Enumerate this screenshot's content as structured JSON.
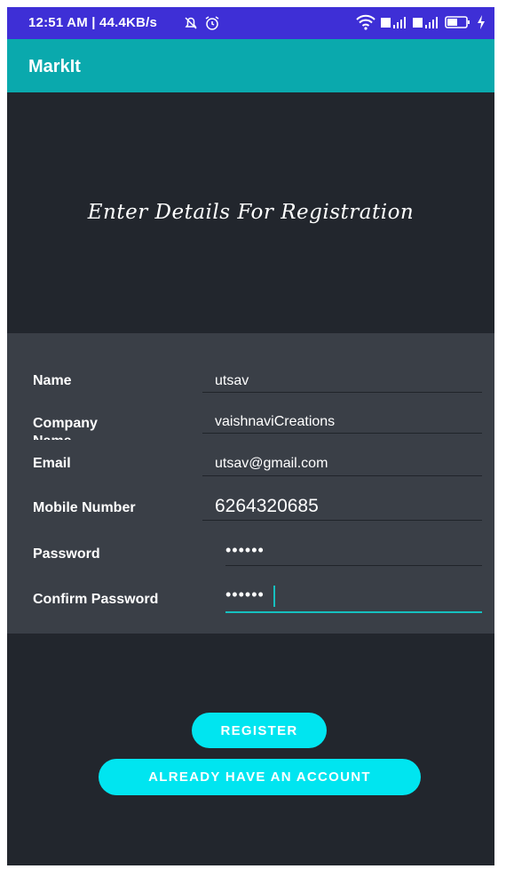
{
  "status_bar": {
    "time_speed": "12:51 AM | 44.4KB/s",
    "icons": [
      "no-notification-icon",
      "alarm-icon",
      "wifi-icon",
      "signal-icon",
      "battery-icon",
      "charging-icon"
    ],
    "battery": "49"
  },
  "app_bar": {
    "title": "MarkIt"
  },
  "hero": {
    "heading": "Enter Details For Registration"
  },
  "form": {
    "fields": [
      {
        "label": "Name",
        "value": "utsav"
      },
      {
        "label": "Company Name",
        "value": "vaishnaviCreations"
      },
      {
        "label": "Email",
        "value": "utsav@gmail.com"
      },
      {
        "label": "Mobile Number",
        "value": "6264320685"
      },
      {
        "label": "Password",
        "value": "••••••"
      },
      {
        "label": "Confirm Password",
        "value": "••••••"
      }
    ]
  },
  "buttons": {
    "register": "REGISTER",
    "login": "ALREADY HAVE AN ACCOUNT"
  },
  "colors": {
    "status_bar": "#3e2fd6",
    "app_bar": "#0aa9ad",
    "accent": "#16c0bf",
    "button": "#00e5f0",
    "background": "#22262d",
    "form_panel": "#3a3f47"
  }
}
